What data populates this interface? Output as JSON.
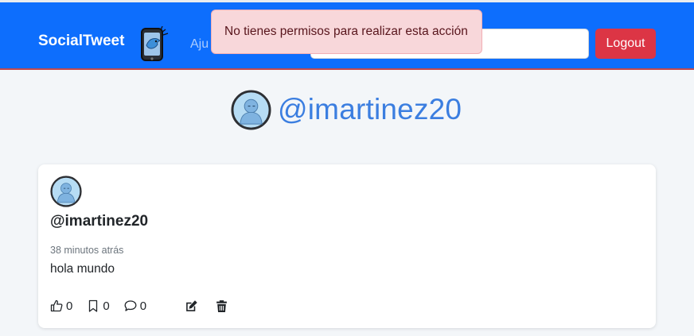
{
  "navbar": {
    "brand": "SocialTweet",
    "brand_logo_icon": "phone-bird-icon",
    "link_label": "Aju",
    "search_value": "",
    "logout_label": "Logout",
    "color": "#0d6efd"
  },
  "toast": {
    "message": "No tienes permisos para realizar esta acción"
  },
  "profile": {
    "username": "@imartinez20"
  },
  "post": {
    "username": "@imartinez20",
    "time": "38 minutos atrás",
    "text": "hola mundo",
    "likes": "0",
    "saves": "0",
    "comments": "0"
  }
}
